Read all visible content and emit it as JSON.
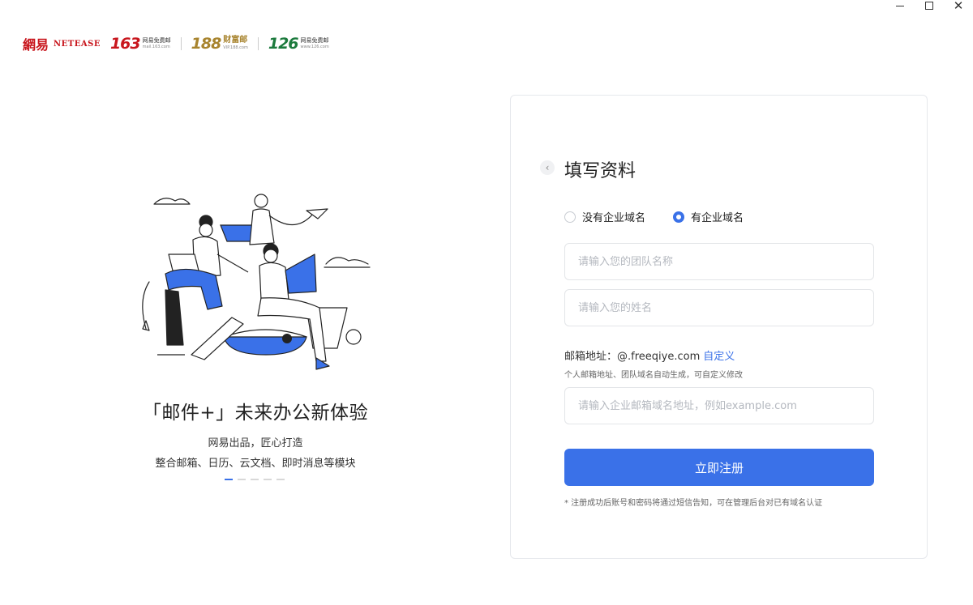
{
  "window_controls": {
    "minimize": "–",
    "maximize": "☐",
    "close": "✕"
  },
  "brands": {
    "netease_cn": "網易",
    "netease_en": "NetEase",
    "b163": {
      "num": "163",
      "sub1": "网易免费邮",
      "sub2": "mail.163.com"
    },
    "b188": {
      "num": "188",
      "sub1": "财富邮",
      "sub2": "VIP.188.com"
    },
    "b126": {
      "num": "126",
      "sub1": "网易免费邮",
      "sub2": "www.126.com"
    }
  },
  "promo": {
    "title": "「邮件+」未来办公新体验",
    "sub1": "网易出品，匠心打造",
    "sub2": "整合邮箱、日历、云文档、即时消息等模块",
    "slides_total": 5,
    "slide_active": 1
  },
  "form": {
    "title": "填写资料",
    "radio_no_domain": "没有企业域名",
    "radio_has_domain": "有企业域名",
    "selected": "has_domain",
    "team_name_placeholder": "请输入您的团队名称",
    "full_name_placeholder": "请输入您的姓名",
    "email_label": "邮箱地址：",
    "email_domain": "@.freeqiye.com",
    "email_custom_link": "自定义",
    "email_hint": "个人邮箱地址、团队域名自动生成，可自定义修改",
    "domain_placeholder": "请输入企业邮箱域名地址，例如example.com",
    "submit_label": "立即注册",
    "notice": "* 注册成功后账号和密码将通过短信告知，可在管理后台对已有域名认证"
  },
  "colors": {
    "accent": "#3a71e8",
    "brand_red": "#c8161d",
    "brand_gold": "#a8842e",
    "brand_green": "#1c7a3d"
  }
}
